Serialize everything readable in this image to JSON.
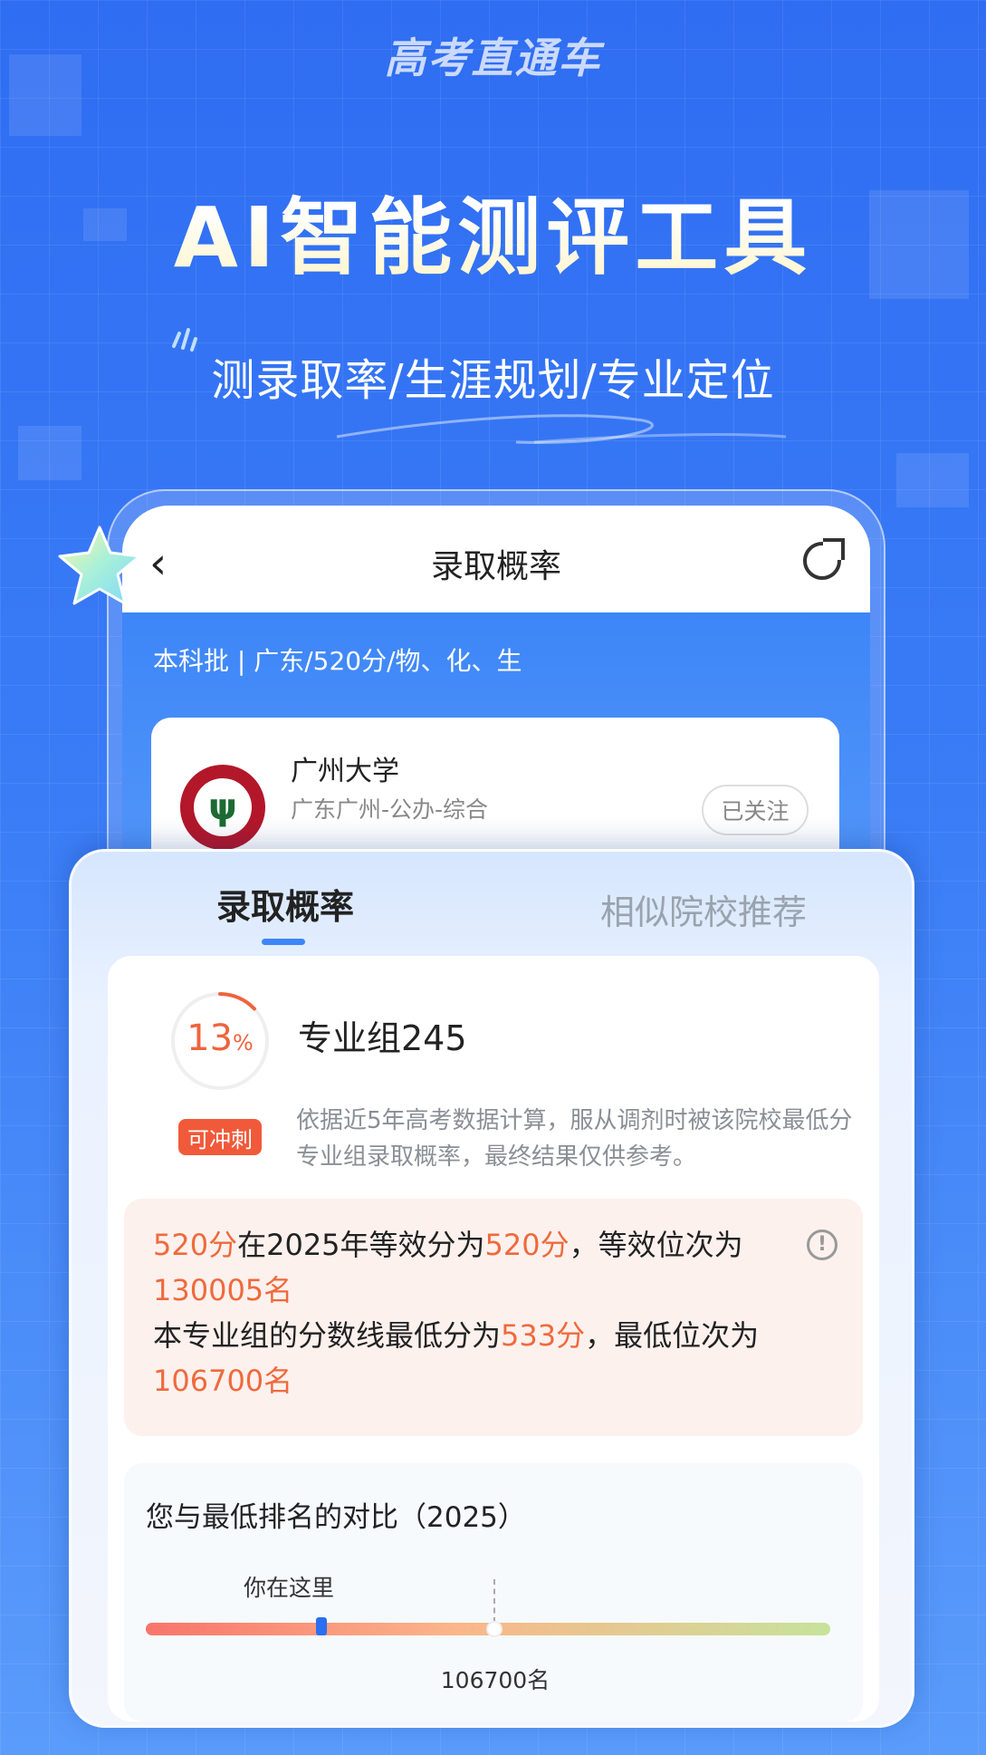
{
  "banner": {
    "brand": "高考直通车",
    "headline": "AI智能测评工具",
    "subheadline": "测录取率/生涯规划/专业定位"
  },
  "phone_screen": {
    "title": "录取概率",
    "meta": "本科批 | 广东/520分/物、化、生",
    "university": {
      "name": "广州大学",
      "location": "广东广州-公办-综合",
      "follow_label": "已关注"
    }
  },
  "tabs": [
    {
      "label": "录取概率",
      "active": true
    },
    {
      "label": "相似院校推荐",
      "active": false
    }
  ],
  "probability": {
    "percent": "13",
    "percent_unit": "%",
    "percent_value": 0.13,
    "group_label": "专业组245",
    "tag": "可冲刺",
    "description": "依据近5年高考数据计算，服从调剂时被该院校最低分专业组录取概率，最终结果仅供参考。"
  },
  "info_box": {
    "score": "520分",
    "t1": "在2025年等效分为",
    "equiv_score": "520分",
    "t2": "，等效位次为",
    "equiv_rank": "130005名",
    "t3": "本专业组的分数线最低分为",
    "min_score": "533分",
    "t4": "，最低位次为",
    "min_rank": "106700名"
  },
  "comparison": {
    "title": "您与最低排名的对比（2025）",
    "you_label": "你在这里",
    "min_rank_label": "106700名"
  },
  "colors": {
    "accent_blue": "#3d86f8",
    "highlight_orange": "#ef6a3c",
    "tag_red": "#f05a3a"
  }
}
